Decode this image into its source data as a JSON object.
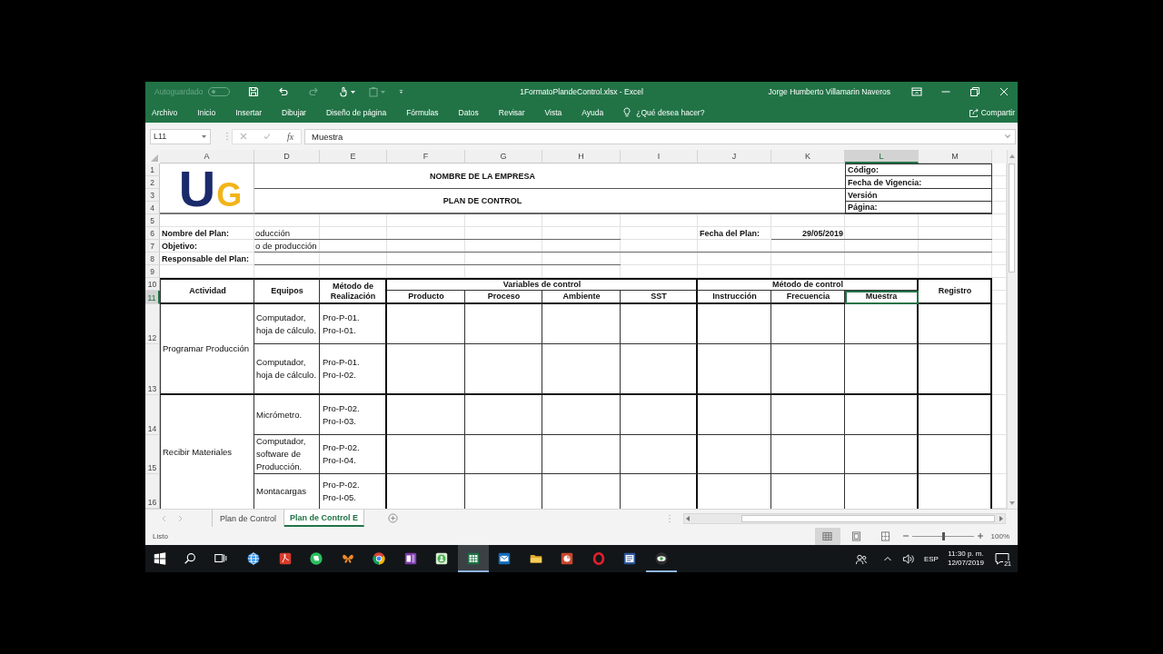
{
  "window": {
    "title": "1FormatoPlandeControl.xlsx - Excel",
    "user": "Jorge Humberto Villamarin Naveros",
    "autosave": {
      "label": "Autoguardado",
      "on": false
    }
  },
  "quick_access": [
    {
      "kind": "save",
      "disabled": false
    },
    {
      "kind": "undo",
      "disabled": false
    },
    {
      "kind": "redo",
      "disabled": true
    },
    {
      "kind": "touch",
      "disabled": false
    },
    {
      "kind": "clipboard",
      "disabled": true
    },
    {
      "kind": "customize",
      "disabled": false
    }
  ],
  "ribbon": {
    "tabs": [
      {
        "label": "Archivo",
        "selected": false
      },
      {
        "label": "Inicio",
        "selected": false
      },
      {
        "label": "Insertar",
        "selected": false
      },
      {
        "label": "Dibujar",
        "selected": false
      },
      {
        "label": "Diseño de página",
        "selected": false
      },
      {
        "label": "Fórmulas",
        "selected": false
      },
      {
        "label": "Datos",
        "selected": false
      },
      {
        "label": "Revisar",
        "selected": false
      },
      {
        "label": "Vista",
        "selected": false
      },
      {
        "label": "Ayuda",
        "selected": false
      }
    ],
    "tell_me": "¿Qué desea hacer?",
    "share": "Compartir"
  },
  "formula_bar": {
    "name_box": "L11",
    "function_button": "fx",
    "value": "Muestra"
  },
  "column_headers": [
    {
      "label": "A",
      "selected": false
    },
    {
      "label": "D",
      "selected": false
    },
    {
      "label": "E",
      "selected": false
    },
    {
      "label": "F",
      "selected": false
    },
    {
      "label": "G",
      "selected": false
    },
    {
      "label": "H",
      "selected": false
    },
    {
      "label": "I",
      "selected": false
    },
    {
      "label": "J",
      "selected": false
    },
    {
      "label": "K",
      "selected": false
    },
    {
      "label": "L",
      "selected": true
    },
    {
      "label": "M",
      "selected": false
    }
  ],
  "row_headers": [
    {
      "label": "1",
      "selected": false
    },
    {
      "label": "2",
      "selected": false
    },
    {
      "label": "3",
      "selected": false
    },
    {
      "label": "4",
      "selected": false
    },
    {
      "label": "5",
      "selected": false
    },
    {
      "label": "6",
      "selected": false
    },
    {
      "label": "7",
      "selected": false
    },
    {
      "label": "8",
      "selected": false
    },
    {
      "label": "9",
      "selected": false
    },
    {
      "label": "10",
      "selected": false
    },
    {
      "label": "11",
      "selected": true
    },
    {
      "label": "12",
      "selected": false
    },
    {
      "label": "13",
      "selected": false
    },
    {
      "label": "14",
      "selected": false
    },
    {
      "label": "15",
      "selected": false
    },
    {
      "label": "16",
      "selected": false
    }
  ],
  "sheet": {
    "logo": {
      "letters": [
        "U",
        "G"
      ]
    },
    "company_name": "NOMBRE DE LA EMPRESA",
    "document_title": "PLAN DE CONTROL",
    "document_fields": [
      "Código:",
      "Fecha de Vigencia:",
      "Versión",
      "Página:"
    ],
    "plan_fields": [
      {
        "label": "Nombre del Plan:",
        "value": "oducción"
      },
      {
        "label": "Objetivo:",
        "value": "o de producción"
      },
      {
        "label": "Responsable del Plan:"
      }
    ],
    "plan_date": {
      "label": "Fecha del Plan:",
      "value": "29/05/2019"
    },
    "table": {
      "columns": [
        {
          "kind": "single",
          "label": "Actividad",
          "selected": false
        },
        {
          "kind": "single",
          "label": "Equipos",
          "selected": false
        },
        {
          "kind": "single",
          "label": "Método de Realización",
          "selected": false
        },
        {
          "kind": "group",
          "label": "Variables de control",
          "selected": false,
          "columns": [
            {
              "label": "Producto",
              "selected": false
            },
            {
              "label": "Proceso",
              "selected": false
            },
            {
              "label": "Ambiente",
              "selected": false
            },
            {
              "label": "SST",
              "selected": false
            }
          ]
        },
        {
          "kind": "group",
          "label": "Método de control",
          "selected": false,
          "columns": [
            {
              "label": "Instrucción",
              "selected": false
            },
            {
              "label": "Frecuencia",
              "selected": false
            },
            {
              "label": "Muestra",
              "selected": true
            }
          ]
        },
        {
          "kind": "single",
          "label": "Registro",
          "selected": false
        }
      ],
      "rows": [
        {
          "activity": "Programar Producción",
          "tasks": [
            {
              "equipment": "Computador, hoja de cálculo.",
              "methods": [
                "Pro-P-01.",
                "Pro-I-01."
              ]
            },
            {
              "equipment": "Computador, hoja de cálculo.",
              "methods": [
                "Pro-P-01.",
                "Pro-I-02."
              ]
            }
          ]
        },
        {
          "activity": "Recibir Materiales",
          "tasks": [
            {
              "equipment": "Micrómetro.",
              "methods": [
                "Pro-P-02.",
                "Pro-I-03."
              ]
            },
            {
              "equipment": "Computador, software de Producción.",
              "methods": [
                "Pro-P-02.",
                "Pro-I-04."
              ]
            },
            {
              "equipment": "Montacargas",
              "methods": [
                "Pro-P-02.",
                "Pro-I-05."
              ]
            }
          ]
        }
      ]
    }
  },
  "sheet_tabs": [
    {
      "label": "Plan de Control",
      "selected": false
    },
    {
      "label": "Plan de Control E",
      "selected": true
    }
  ],
  "status_bar": {
    "status": "Listo",
    "views": [
      {
        "kind": "normal",
        "selected": true
      },
      {
        "kind": "page_layout",
        "selected": false
      },
      {
        "kind": "page_break",
        "selected": false
      }
    ],
    "zoom_slider": {
      "level": 0.5
    },
    "zoom": "100%"
  },
  "taskbar": {
    "apps": [
      {
        "kind": "browser",
        "selected": false,
        "running": false
      },
      {
        "kind": "reader",
        "selected": false,
        "running": false
      },
      {
        "kind": "elephant",
        "selected": false,
        "running": false
      },
      {
        "kind": "butterfly",
        "selected": false,
        "running": false
      },
      {
        "kind": "chrome",
        "selected": false,
        "running": false
      },
      {
        "kind": "notebook",
        "selected": false,
        "running": false
      },
      {
        "kind": "figure",
        "selected": false,
        "running": false
      },
      {
        "kind": "spreadsheet",
        "selected": true,
        "running": true
      },
      {
        "kind": "mail",
        "selected": false,
        "running": false
      },
      {
        "kind": "folder",
        "selected": false,
        "running": false
      },
      {
        "kind": "slides",
        "selected": false,
        "running": false
      },
      {
        "kind": "ring",
        "selected": false,
        "running": false
      },
      {
        "kind": "document",
        "selected": false,
        "running": false
      },
      {
        "kind": "eye",
        "selected": false,
        "running": true
      }
    ],
    "language": "ESP",
    "time": "11:30 p. m.",
    "date": "12/07/2019",
    "notifications": "21"
  }
}
